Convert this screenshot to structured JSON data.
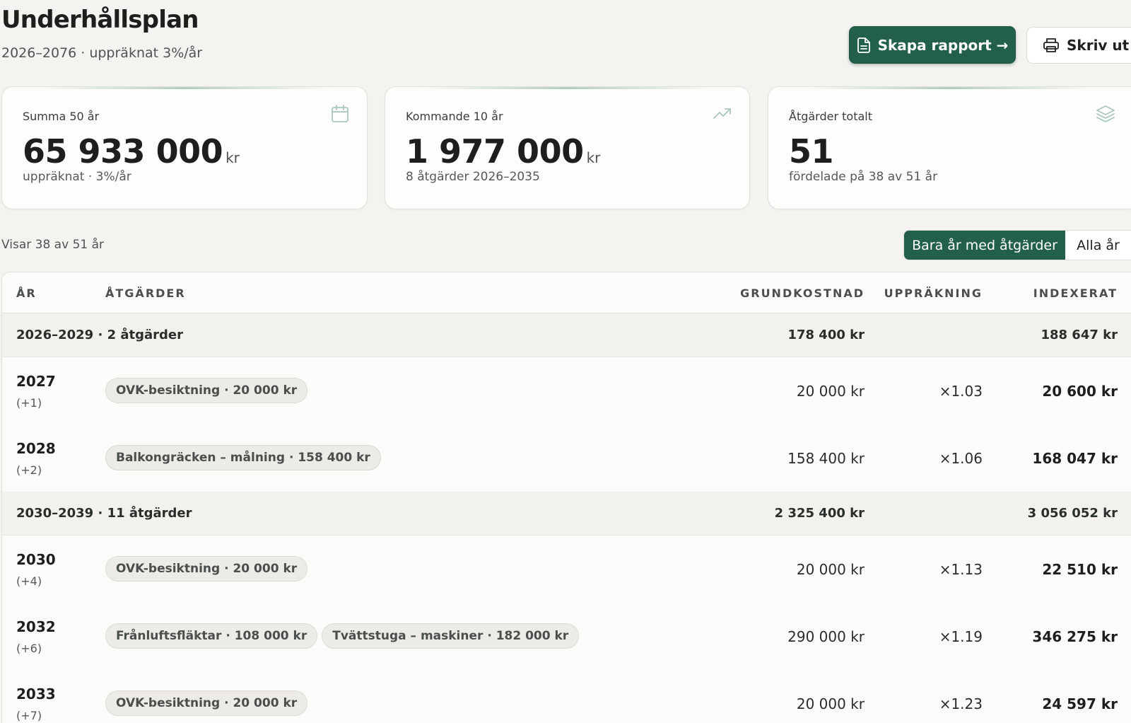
{
  "header": {
    "title": "Underhållsplan",
    "subtitle": "2026–2076 · uppräknat 3%/år",
    "report_button": "Skapa rapport →",
    "print_button": "Skriv ut"
  },
  "cards": [
    {
      "label": "Summa 50 år",
      "value": "65 933 000",
      "unit": "kr",
      "sub": "uppräknat · 3%/år",
      "icon": "calendar-icon"
    },
    {
      "label": "Kommande 10 år",
      "value": "1 977 000",
      "unit": "kr",
      "sub": "8 åtgärder 2026–2035",
      "icon": "trending-up-icon"
    },
    {
      "label": "Åtgärder totalt",
      "value": "51",
      "unit": "",
      "sub": "fördelade på 38 av 51 år",
      "icon": "layers-icon"
    }
  ],
  "filter": {
    "showing": "Visar 38 av 51 år",
    "options": [
      "Bara år med åtgärder",
      "Alla år"
    ],
    "active": "Bara år med åtgärder"
  },
  "table": {
    "columns": {
      "year": "ÅR",
      "actions": "ÅTGÄRDER",
      "base": "GRUNDKOSTNAD",
      "factor": "UPPRÄKNING",
      "indexed": "INDEXERAT"
    },
    "group1": {
      "label": "2026–2029 · 2 åtgärder",
      "base": "178 400 kr",
      "indexed": "188 647 kr"
    },
    "row2027": {
      "year": "2027",
      "offset": "(+1)",
      "chips": [
        "OVK-besiktning · 20 000 kr"
      ],
      "base": "20 000 kr",
      "factor": "×1.03",
      "indexed": "20 600 kr"
    },
    "row2028": {
      "year": "2028",
      "offset": "(+2)",
      "chips": [
        "Balkongräcken – målning · 158 400 kr"
      ],
      "base": "158 400 kr",
      "factor": "×1.06",
      "indexed": "168 047 kr"
    },
    "group2": {
      "label": "2030–2039 · 11 åtgärder",
      "base": "2 325 400 kr",
      "indexed": "3 056 052 kr"
    },
    "row2030": {
      "year": "2030",
      "offset": "(+4)",
      "chips": [
        "OVK-besiktning · 20 000 kr"
      ],
      "base": "20 000 kr",
      "factor": "×1.13",
      "indexed": "22 510 kr"
    },
    "row2032": {
      "year": "2032",
      "offset": "(+6)",
      "chips": [
        "Frånluftsfläktar · 108 000 kr",
        "Tvättstuga – maskiner · 182 000 kr"
      ],
      "base": "290 000 kr",
      "factor": "×1.19",
      "indexed": "346 275 kr"
    },
    "row2033": {
      "year": "2033",
      "offset": "(+7)",
      "chips": [
        "OVK-besiktning · 20 000 kr"
      ],
      "base": "20 000 kr",
      "factor": "×1.23",
      "indexed": "24 597 kr"
    }
  },
  "colors": {
    "accent": "#23604c",
    "background": "#f4f3ef"
  }
}
